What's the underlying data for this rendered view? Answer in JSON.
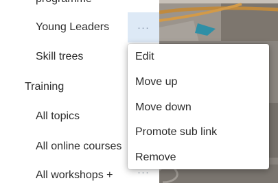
{
  "nav": {
    "items": [
      {
        "label": "programme"
      },
      {
        "label": "Young Leaders"
      },
      {
        "label": "Skill trees"
      },
      {
        "label": "Training"
      },
      {
        "label": "All topics"
      },
      {
        "label": "All online courses"
      },
      {
        "label": "All workshops +"
      }
    ],
    "more_label": "···"
  },
  "context_menu": {
    "items": [
      "Edit",
      "Move up",
      "Move down",
      "Promote sub link",
      "Remove"
    ]
  },
  "colors": {
    "selected_bg": "#dde9f6",
    "text": "#2b2b2b"
  }
}
